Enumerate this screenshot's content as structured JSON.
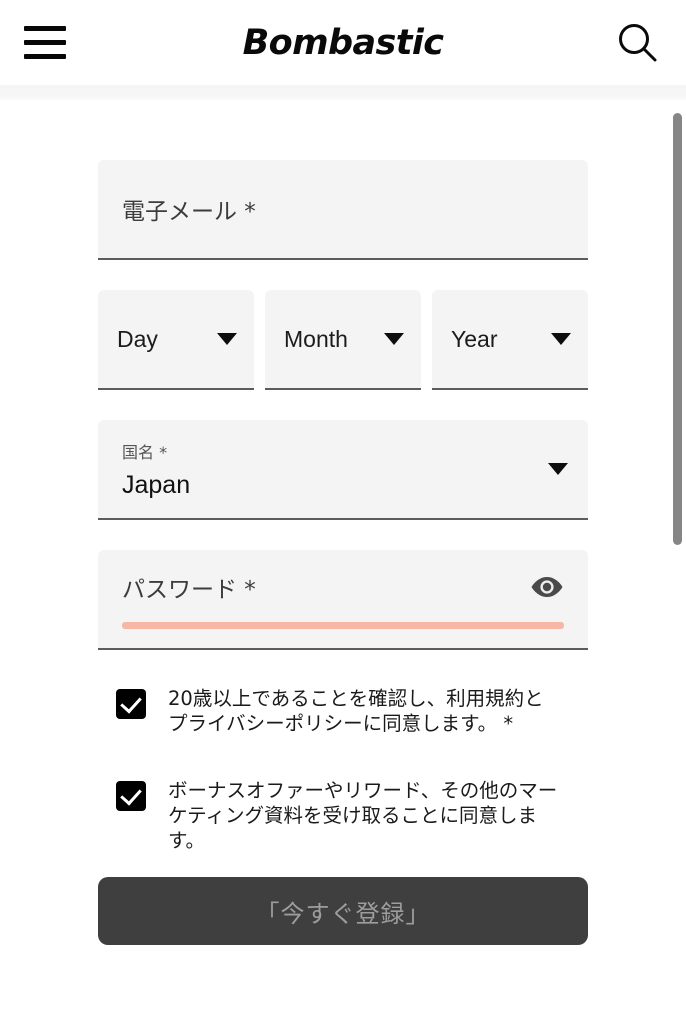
{
  "header": {
    "brand": "Bombastic",
    "menu_icon": "hamburger-menu-icon",
    "search_icon": "search-icon"
  },
  "form": {
    "email": {
      "placeholder": "電子メール *",
      "value": ""
    },
    "birthdate": {
      "day": {
        "label": "Day",
        "value": "Day"
      },
      "month": {
        "label": "Month",
        "value": "Month"
      },
      "year": {
        "label": "Year",
        "value": "Year"
      }
    },
    "country": {
      "label": "国名 *",
      "value": "Japan"
    },
    "password": {
      "placeholder": "パスワード *",
      "value": "",
      "reveal_icon": "eye-icon",
      "strength_color": "#f7b7a7"
    },
    "consents": [
      {
        "checked": true,
        "text": "20歳以上であることを確認し、利用規約とプライバシーポリシーに同意します。 *"
      },
      {
        "checked": true,
        "text": "ボーナスオファーやリワード、その他のマーケティング資料を受け取ることに同意します。"
      }
    ],
    "submit": {
      "label": "「今すぐ登録」",
      "enabled": false,
      "background": "#3f3f3f",
      "text_color": "#9d9d9d"
    }
  },
  "scrollbar": {
    "visible": true,
    "color": "#868686"
  }
}
